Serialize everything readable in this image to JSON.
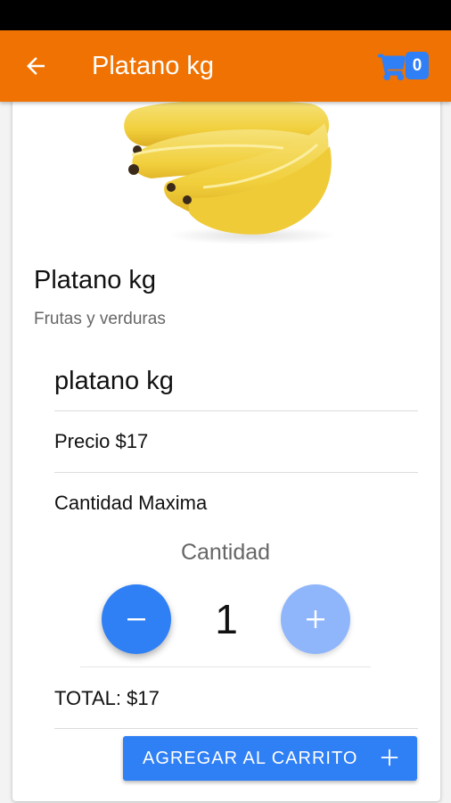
{
  "app_bar": {
    "title": "Platano kg",
    "cart_count": "0",
    "colors": {
      "background": "#ef7202",
      "badge": "#2f7ff7"
    }
  },
  "product": {
    "title": "Platano kg",
    "category": "Frutas y verduras",
    "name": "platano kg",
    "price_text": "Precio $17",
    "max_quantity_text": "Cantidad Maxima"
  },
  "quantity": {
    "label": "Cantidad",
    "value": "1",
    "minus_symbol": "−",
    "plus_symbol": "+"
  },
  "total_text": "TOTAL: $17",
  "add_to_cart": {
    "label": "AGREGAR AL CARRITO",
    "icon": "plus-icon"
  },
  "icons": [
    "arrow-back-icon",
    "shopping-cart-icon",
    "minus-icon",
    "plus-icon"
  ],
  "accent_color": "#2f7ff5"
}
